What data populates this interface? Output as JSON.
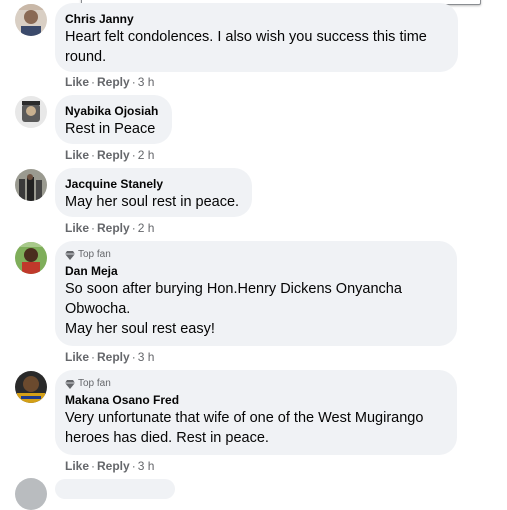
{
  "comments": [
    {
      "name": "Chris Janny",
      "text": [
        "Heart felt condolences. I also wish you success this time",
        "round."
      ],
      "like": "Like",
      "reply": "Reply",
      "time": "3 h"
    },
    {
      "name": "Nyabika Ojosiah",
      "text": [
        "Rest in Peace"
      ],
      "like": "Like",
      "reply": "Reply",
      "time": "2 h"
    },
    {
      "name": "Jacquine Stanely",
      "text": [
        "May her soul rest in peace."
      ],
      "like": "Like",
      "reply": "Reply",
      "time": "2 h"
    },
    {
      "badge": "Top fan",
      "name": "Dan Meja",
      "text": [
        "So soon after burying Hon.Henry Dickens Onyancha",
        "Obwocha.",
        "May her soul rest easy!"
      ],
      "like": "Like",
      "reply": "Reply",
      "time": "3 h"
    },
    {
      "badge": "Top fan",
      "name": "Makana Osano Fred",
      "text": [
        "Very unfortunate that wife of one of the West Mugirango",
        "heroes has died. Rest in peace."
      ],
      "like": "Like",
      "reply": "Reply",
      "time": "3 h"
    }
  ],
  "separator": "·",
  "icons": {
    "badge": "diamond-icon"
  },
  "colors": {
    "bubble": "#f0f2f5",
    "meta": "#65676b",
    "text": "#050505"
  }
}
